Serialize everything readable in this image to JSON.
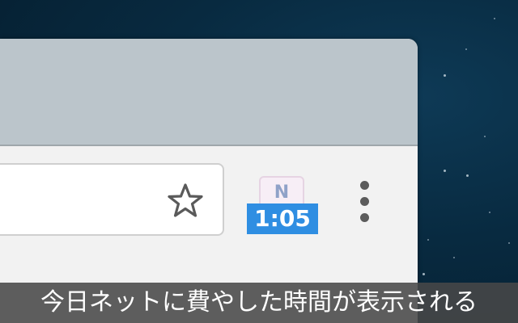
{
  "extension": {
    "icon_letter": "N",
    "badge_text": "1:05",
    "badge_color": "#2f8ee2"
  },
  "toolbar": {
    "bookmark_icon": "star-outline-icon",
    "menu_icon": "vertical-dots-icon"
  },
  "caption": {
    "text": "今日ネットに費やした時間が表示される"
  },
  "colors": {
    "titlebar": "#bbc5cb",
    "toolbar": "#f2f2f2",
    "caption_bg": "#484848"
  }
}
